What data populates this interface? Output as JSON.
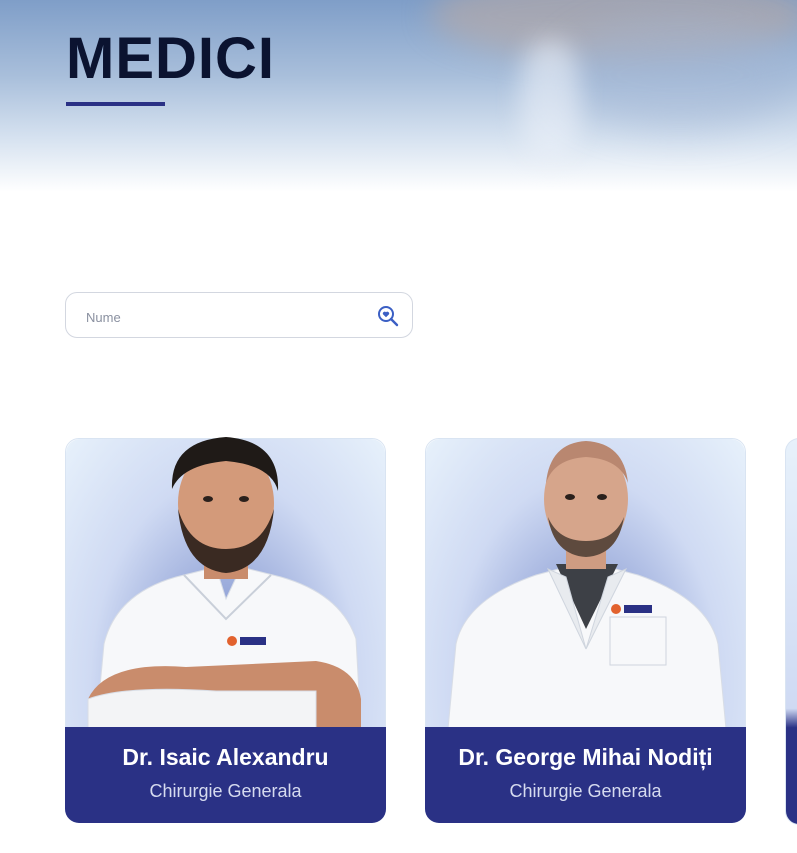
{
  "header": {
    "title": "MEDICI"
  },
  "search": {
    "placeholder": "Nume",
    "value": ""
  },
  "doctors": [
    {
      "name": "Dr. Isaic Alexandru",
      "specialty": "Chirurgie Generala"
    },
    {
      "name": "Dr. George Mihai Nodiți",
      "specialty": "Chirurgie Generala"
    }
  ],
  "colors": {
    "brand": "#2a3185",
    "title": "#0b1330",
    "search_icon": "#3b5fc4"
  }
}
